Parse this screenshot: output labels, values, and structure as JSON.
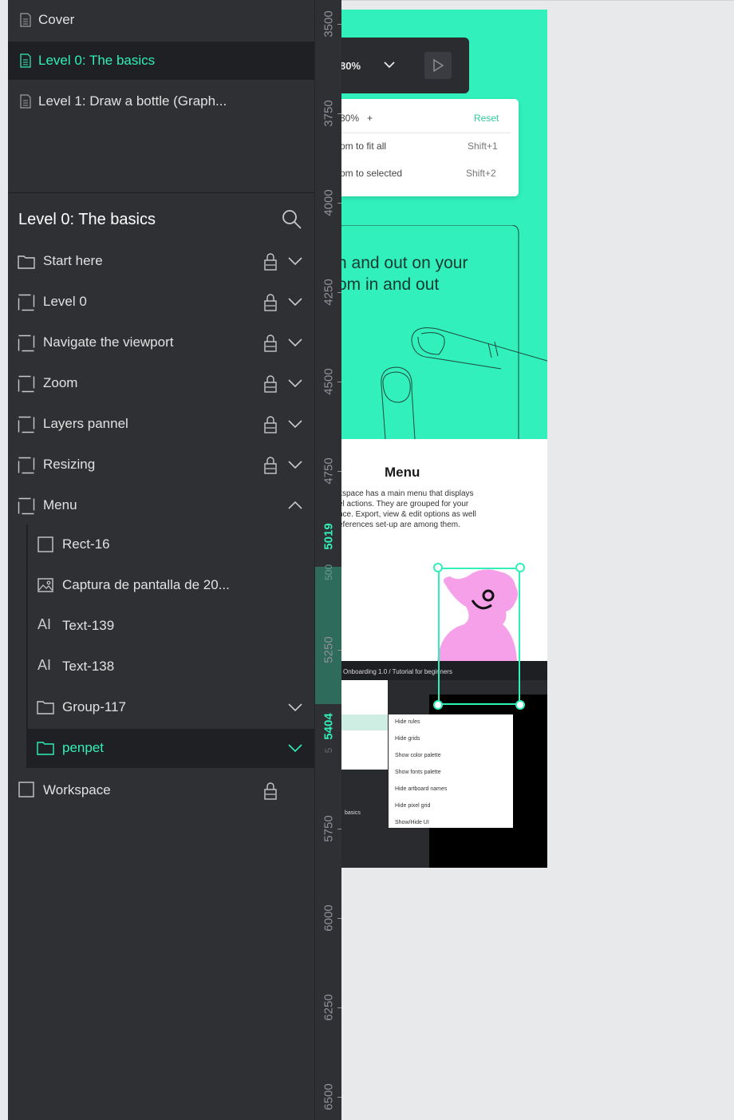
{
  "pages": [
    {
      "label": "Cover",
      "active": false
    },
    {
      "label": "Level 0: The basics",
      "active": true
    },
    {
      "label": "Level 1: Draw a bottle (Graph..."
    }
  ],
  "layers": {
    "title": "Level 0: The basics",
    "items": [
      {
        "label": "Start here",
        "icon": "folder-icon"
      },
      {
        "label": "Level 0",
        "icon": "board-icon"
      },
      {
        "label": "Navigate the viewport",
        "icon": "board-icon"
      },
      {
        "label": "Zoom",
        "icon": "board-icon"
      },
      {
        "label": "Layers pannel",
        "icon": "board-icon"
      },
      {
        "label": "Resizing",
        "icon": "board-icon"
      },
      {
        "label": "Menu",
        "icon": "board-icon",
        "expanded": true
      },
      {
        "label": "Rect-16",
        "icon": "rect-icon"
      },
      {
        "label": "Captura de pantalla de 20...",
        "icon": "image-icon"
      },
      {
        "label": "Text-139",
        "icon": "text-icon",
        "glyph": "AI"
      },
      {
        "label": "Text-138",
        "icon": "text-icon",
        "glyph": "AI"
      },
      {
        "label": "Group-117",
        "icon": "folder-icon"
      },
      {
        "label": "penpet",
        "icon": "folder-icon",
        "selected": true
      },
      {
        "label": "Workspace",
        "icon": "rect-icon"
      }
    ]
  },
  "ruler": {
    "labels": [
      "3500",
      "3750",
      "4000",
      "4250",
      "4500",
      "4750",
      "5250",
      "5750",
      "6000",
      "6250",
      "6500"
    ],
    "selection_start": "5019",
    "selection_end": "5404",
    "dim_labels": [
      "500",
      "5"
    ]
  },
  "canvas": {
    "zoom_value": "80%",
    "zoom_menu": {
      "zoom_label": "80%",
      "plus": "+",
      "reset": "Reset",
      "fit_all": "om to fit all",
      "fit_all_shortcut": "Shift+1",
      "selected": "om to selected",
      "selected_shortcut": "Shift+2"
    },
    "illustration_text": [
      "n and out on your",
      "om in and out"
    ],
    "menu_title": "Menu",
    "menu_desc": [
      "kspace has a main menu that displays",
      "el actions. They are grouped for your",
      "nce. Export, view & edit options as well",
      "eferences set-up are among them."
    ],
    "screenshot": {
      "breadcrumb": "Onboarding 1.0 / Tutorial for beginners",
      "menu_items": [
        "Hide rules",
        "Hide grids",
        "Show color palette",
        "Show fonts palette",
        "Hide artboard names",
        "Hide pixel grid",
        "Show/Hide UI"
      ],
      "basics_label": "basics"
    }
  },
  "colors": {
    "accent": "#31efb8",
    "panel": "#2e3034",
    "pink": "#f7a0ea"
  }
}
